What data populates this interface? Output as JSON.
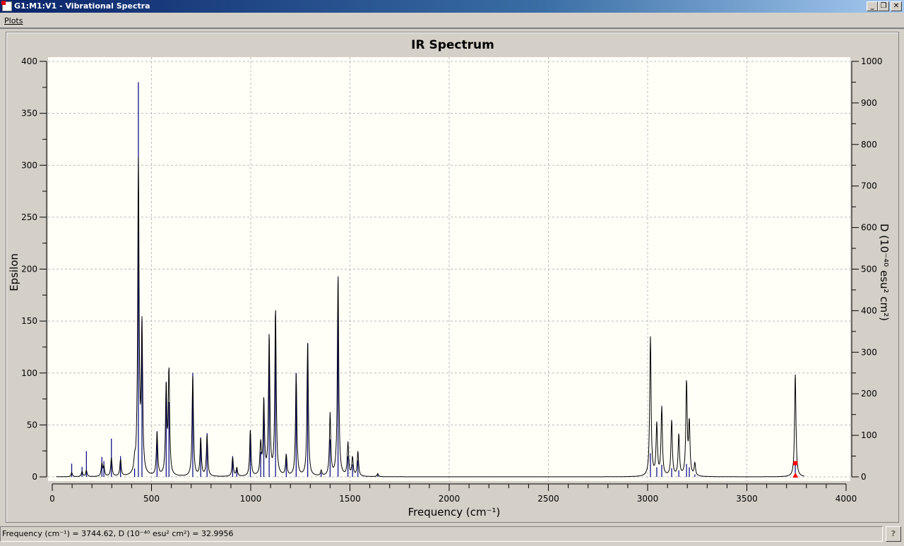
{
  "window": {
    "title": "G1:M1:V1 - Vibrational Spectra",
    "minimize": "_",
    "restore": "❐",
    "close": "✕"
  },
  "menu": {
    "plots": "Plots"
  },
  "status": {
    "text": "Frequency (cm⁻¹) = 3744.62, D (10⁻⁴⁰ esu² cm²) = 32.9956",
    "help": "?"
  },
  "chart_data": {
    "type": "line",
    "title": "IR Spectrum",
    "xlabel": "Frequency (cm⁻¹)",
    "ylabel": "Epsilon",
    "y2label": "D (10⁻⁴⁰ esu² cm²)",
    "xlim": [
      0,
      4000
    ],
    "ylim": [
      0,
      400
    ],
    "y2lim": [
      0,
      1000
    ],
    "xticks": [
      0,
      500,
      1000,
      1500,
      2000,
      2500,
      3000,
      3500,
      4000
    ],
    "yticks": [
      0,
      50,
      100,
      150,
      200,
      250,
      300,
      350,
      400
    ],
    "y2ticks": [
      0,
      100,
      200,
      300,
      400,
      500,
      600,
      700,
      800,
      900,
      1000
    ],
    "grid": true,
    "colors": {
      "curve": "#000000",
      "sticks": "#000080",
      "marker": "#ff0000",
      "plot_bg": "#fffff8"
    },
    "peaks": [
      {
        "freq": 98,
        "epsilon": 4,
        "D": 32
      },
      {
        "freq": 150,
        "epsilon": 5,
        "D": 24
      },
      {
        "freq": 172,
        "epsilon": 6,
        "D": 62
      },
      {
        "freq": 250,
        "epsilon": 12,
        "D": 48
      },
      {
        "freq": 260,
        "epsilon": 9,
        "D": 38
      },
      {
        "freq": 298,
        "epsilon": 18,
        "D": 92
      },
      {
        "freq": 344,
        "epsilon": 16,
        "D": 50
      },
      {
        "freq": 415,
        "epsilon": 10,
        "D": 20
      },
      {
        "freq": 434,
        "epsilon": 300,
        "D": 950
      },
      {
        "freq": 452,
        "epsilon": 140,
        "D": 375
      },
      {
        "freq": 528,
        "epsilon": 42,
        "D": 110
      },
      {
        "freq": 574,
        "epsilon": 85,
        "D": 220
      },
      {
        "freq": 588,
        "epsilon": 100,
        "D": 180
      },
      {
        "freq": 708,
        "epsilon": 98,
        "D": 250
      },
      {
        "freq": 748,
        "epsilon": 36,
        "D": 95
      },
      {
        "freq": 780,
        "epsilon": 40,
        "D": 105
      },
      {
        "freq": 909,
        "epsilon": 18,
        "D": 50
      },
      {
        "freq": 930,
        "epsilon": 8,
        "D": 18
      },
      {
        "freq": 998,
        "epsilon": 44,
        "D": 110
      },
      {
        "freq": 1050,
        "epsilon": 30,
        "D": 60
      },
      {
        "freq": 1066,
        "epsilon": 72,
        "D": 180
      },
      {
        "freq": 1093,
        "epsilon": 135,
        "D": 300
      },
      {
        "freq": 1125,
        "epsilon": 160,
        "D": 340
      },
      {
        "freq": 1179,
        "epsilon": 20,
        "D": 55
      },
      {
        "freq": 1229,
        "epsilon": 98,
        "D": 250
      },
      {
        "freq": 1287,
        "epsilon": 130,
        "D": 320
      },
      {
        "freq": 1355,
        "epsilon": 5,
        "D": 10
      },
      {
        "freq": 1400,
        "epsilon": 60,
        "D": 90
      },
      {
        "freq": 1440,
        "epsilon": 195,
        "D": 400
      },
      {
        "freq": 1490,
        "epsilon": 32,
        "D": 50
      },
      {
        "freq": 1513,
        "epsilon": 18,
        "D": 30
      },
      {
        "freq": 1540,
        "epsilon": 24,
        "D": 40
      },
      {
        "freq": 1640,
        "epsilon": 3,
        "D": 5
      },
      {
        "freq": 3014,
        "epsilon": 134,
        "D": 57
      },
      {
        "freq": 3046,
        "epsilon": 50,
        "D": 23
      },
      {
        "freq": 3071,
        "epsilon": 66,
        "D": 29
      },
      {
        "freq": 3121,
        "epsilon": 54,
        "D": 21
      },
      {
        "freq": 3157,
        "epsilon": 40,
        "D": 16
      },
      {
        "freq": 3196,
        "epsilon": 90,
        "D": 31
      },
      {
        "freq": 3210,
        "epsilon": 50,
        "D": 23
      },
      {
        "freq": 3238,
        "epsilon": 12,
        "D": 6
      },
      {
        "freq": 3744,
        "epsilon": 100,
        "D": 33
      }
    ],
    "selected": {
      "freq": 3744.62,
      "D": 32.9956
    }
  }
}
